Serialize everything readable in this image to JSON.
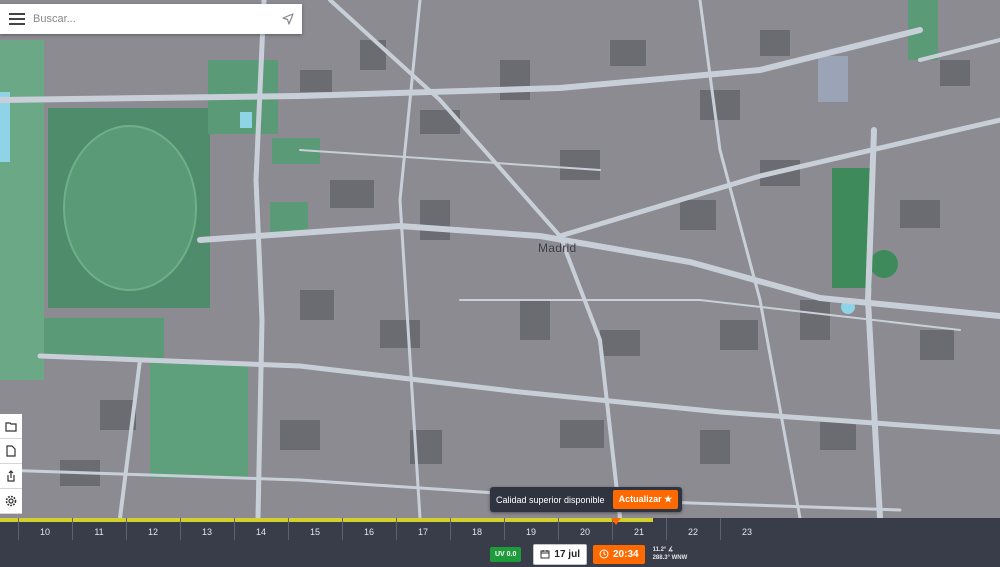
{
  "search": {
    "placeholder": "Buscar..."
  },
  "map": {
    "city_label": "Madrid",
    "colors": {
      "ground": "#8b8b91",
      "road": "#c9cfd8",
      "park": "#5a9a76",
      "water": "#8fd4e6",
      "building": "#6b6b72"
    }
  },
  "sidebar": {
    "buttons": [
      "folder-open-icon",
      "file-icon",
      "share-icon",
      "settings-icon"
    ]
  },
  "notice": {
    "message": "Calidad superior disponible",
    "button_label": "Actualizar ★"
  },
  "timeline": {
    "hours": [
      "10",
      "11",
      "12",
      "13",
      "14",
      "15",
      "16",
      "17",
      "18",
      "19",
      "20",
      "21",
      "22",
      "23"
    ],
    "current_time_hours": 20.57,
    "progress_until_hours": 21.25,
    "uv_label": "UV 0.0",
    "date_label": "17 jul",
    "time_label": "20:34",
    "sun_altitude": "11.2° ∡",
    "sun_azimuth": "288.3° WNW"
  },
  "colors": {
    "accent": "#ff6a00",
    "progress": "#d3cf2d",
    "panel": "#383d49",
    "uv_badge": "#1e9b3a"
  }
}
